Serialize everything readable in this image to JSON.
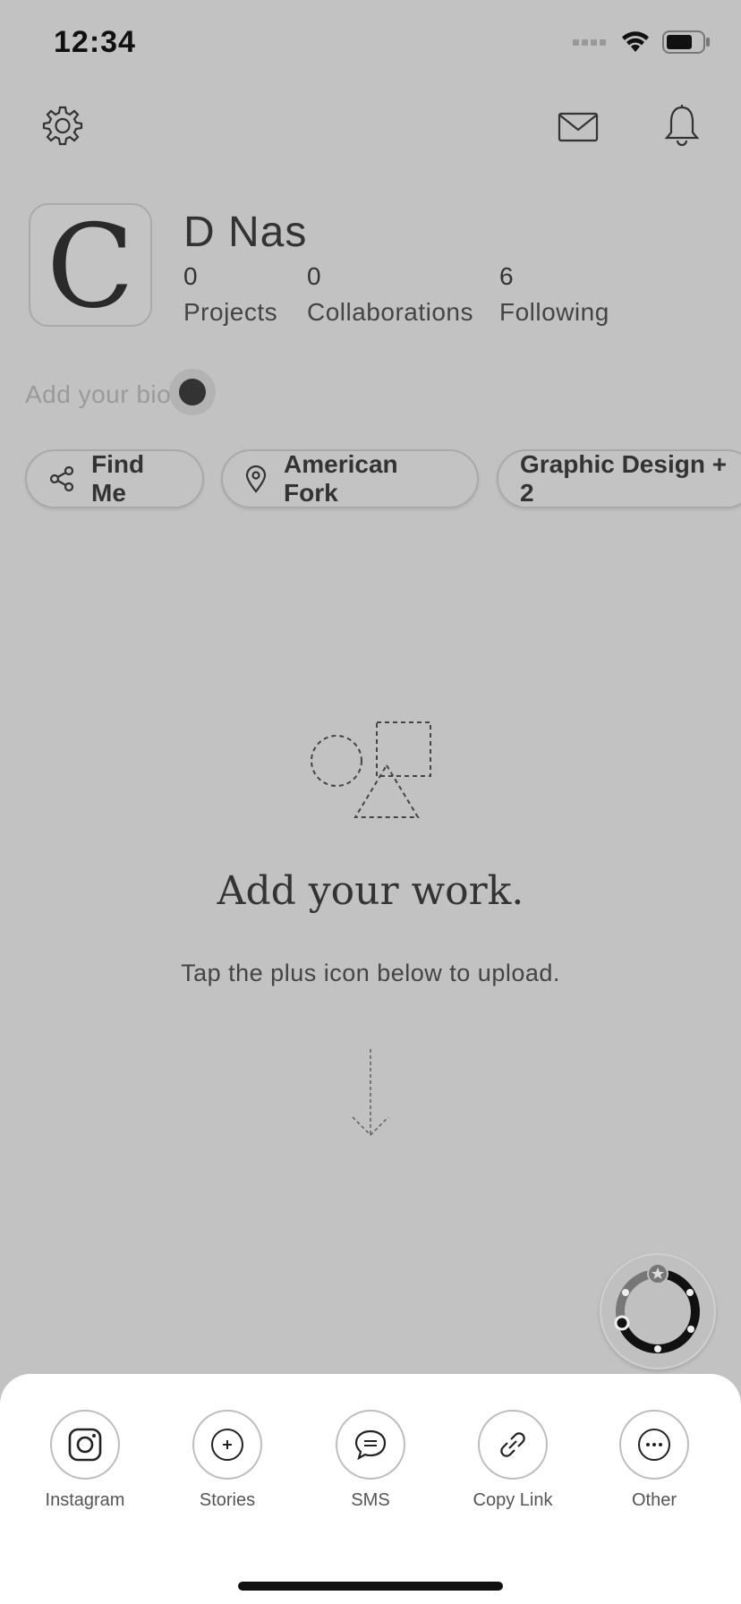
{
  "status_bar": {
    "time": "12:34"
  },
  "profile": {
    "avatar_letter": "C",
    "name": "D Nas",
    "stats": [
      {
        "value": "0",
        "label": "Projects"
      },
      {
        "value": "0",
        "label": "Collaborations"
      },
      {
        "value": "6",
        "label": "Following"
      }
    ],
    "bio_placeholder": "Add your bio"
  },
  "chips": [
    {
      "label": "Find Me",
      "icon": "share-icon"
    },
    {
      "label": "American Fork",
      "icon": "location-pin-icon"
    },
    {
      "label": "Graphic Design + 2",
      "icon": ""
    }
  ],
  "empty_state": {
    "title": "Add your work.",
    "subtitle": "Tap the plus icon below to upload."
  },
  "share_sheet": {
    "items": [
      {
        "label": "Instagram",
        "icon": "instagram-icon"
      },
      {
        "label": "Stories",
        "icon": "plus-circle-icon"
      },
      {
        "label": "SMS",
        "icon": "chat-icon"
      },
      {
        "label": "Copy Link",
        "icon": "link-icon"
      },
      {
        "label": "Other",
        "icon": "more-icon"
      }
    ]
  },
  "colors": {
    "background": "#c2c2c2",
    "sheet": "#ffffff",
    "text": "#333333"
  }
}
